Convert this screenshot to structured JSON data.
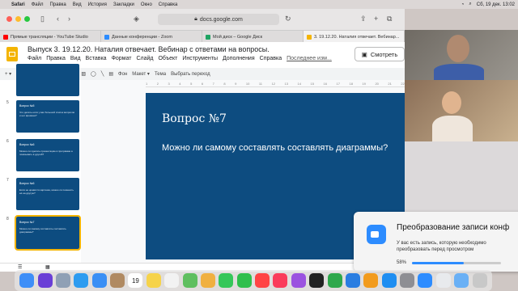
{
  "menubar": {
    "items": [
      "Safari",
      "Файл",
      "Правка",
      "Вид",
      "История",
      "Закладки",
      "Окно",
      "Справка"
    ],
    "clock": "Сб, 19 дек.  13:02"
  },
  "browser": {
    "address": "docs.google.com",
    "tabs": [
      {
        "label": "Прямые трансляции - YouTube Studio",
        "color": "#ff0000"
      },
      {
        "label": "Данные конференции - Zoom",
        "color": "#2d8cff"
      },
      {
        "label": "Мой диск – Google Диск",
        "color": "#1fa463"
      },
      {
        "label": "3. 19.12.20. Наталия отвечает. Вебинар...",
        "color": "#f4b400"
      }
    ]
  },
  "slides_app": {
    "doc_title": "Выпуск 3. 19.12.20. Наталия отвечает. Вебинар с ответами на вопросы.",
    "menu": [
      "Файл",
      "Правка",
      "Вид",
      "Вставка",
      "Формат",
      "Слайд",
      "Объект",
      "Инструменты",
      "Дополнения",
      "Справка"
    ],
    "last_edit": "Последнее изм...",
    "present_label": "Смотреть",
    "toolbar": [
      "Фон",
      "Макет ▾",
      "Тема",
      "Выбрать переход"
    ],
    "ruler": [
      "1",
      "2",
      "3",
      "4",
      "5",
      "6",
      "7",
      "8",
      "9",
      "10",
      "11",
      "12",
      "13",
      "14",
      "15",
      "16",
      "17",
      "18",
      "19",
      "20",
      "21",
      "22"
    ]
  },
  "filmstrip": [
    {
      "num": "",
      "title": "",
      "text": ""
    },
    {
      "num": "5",
      "title": "Вопрос №5",
      "text": "Что делать если у вас большой список вопросов и нет времени?"
    },
    {
      "num": "6",
      "title": "Вопрос №6",
      "text": "Можно ли сделать презентацию в программе а показывать в другой?"
    },
    {
      "num": "7",
      "title": "Вопрос №6",
      "text": "Если не нравится картинка, можно ли поменять её на другую?"
    },
    {
      "num": "8",
      "title": "Вопрос №7",
      "text": "Можно ли самому составлять составлять диаграммы?"
    }
  ],
  "slide": {
    "title": "Вопрос №7",
    "body": "Можно ли самому составлять составлять диаграммы?"
  },
  "notification": {
    "title": "Преобразование записи конф",
    "text": "У вас есть запись, которую необходимо преобразовать перед просмотром",
    "progress_label": "58%",
    "progress": 0.58
  },
  "dock": [
    {
      "icon": "finder-icon",
      "color": "#3e8ef7"
    },
    {
      "icon": "siri-icon",
      "color": "#6a3fd6"
    },
    {
      "icon": "launchpad-icon",
      "color": "#8fa0b5"
    },
    {
      "icon": "safari-icon",
      "color": "#2e9cf0"
    },
    {
      "icon": "mail-icon",
      "color": "#3a8ff5"
    },
    {
      "icon": "contacts-icon",
      "color": "#b08a62"
    },
    {
      "icon": "calendar-icon",
      "color": "#ffffff"
    },
    {
      "icon": "notes-icon",
      "color": "#f6d34a"
    },
    {
      "icon": "reminders-icon",
      "color": "#f2f2f2"
    },
    {
      "icon": "maps-icon",
      "color": "#5fbf5f"
    },
    {
      "icon": "photos-icon",
      "color": "#f0b040"
    },
    {
      "icon": "messages-icon",
      "color": "#35c759"
    },
    {
      "icon": "facetime-icon",
      "color": "#2fbf4c"
    },
    {
      "icon": "news-icon",
      "color": "#f44"
    },
    {
      "icon": "music-icon",
      "color": "#fa3c5b"
    },
    {
      "icon": "podcasts-icon",
      "color": "#9b52e0"
    },
    {
      "icon": "tv-icon",
      "color": "#222"
    },
    {
      "icon": "numbers-icon",
      "color": "#2ea84b"
    },
    {
      "icon": "keynote-icon",
      "color": "#2a7de1"
    },
    {
      "icon": "pages-icon",
      "color": "#f29b1d"
    },
    {
      "icon": "appstore-icon",
      "color": "#1f8ef1"
    },
    {
      "icon": "settings-icon",
      "color": "#8e8e93"
    },
    {
      "icon": "zoom-icon",
      "color": "#2d8cff"
    },
    {
      "icon": "chrome-icon",
      "color": "#e8eaed"
    },
    {
      "icon": "folder-icon",
      "color": "#6ab0f5"
    },
    {
      "icon": "trash-icon",
      "color": "#c8c8c8"
    }
  ],
  "calendar_day": "19"
}
